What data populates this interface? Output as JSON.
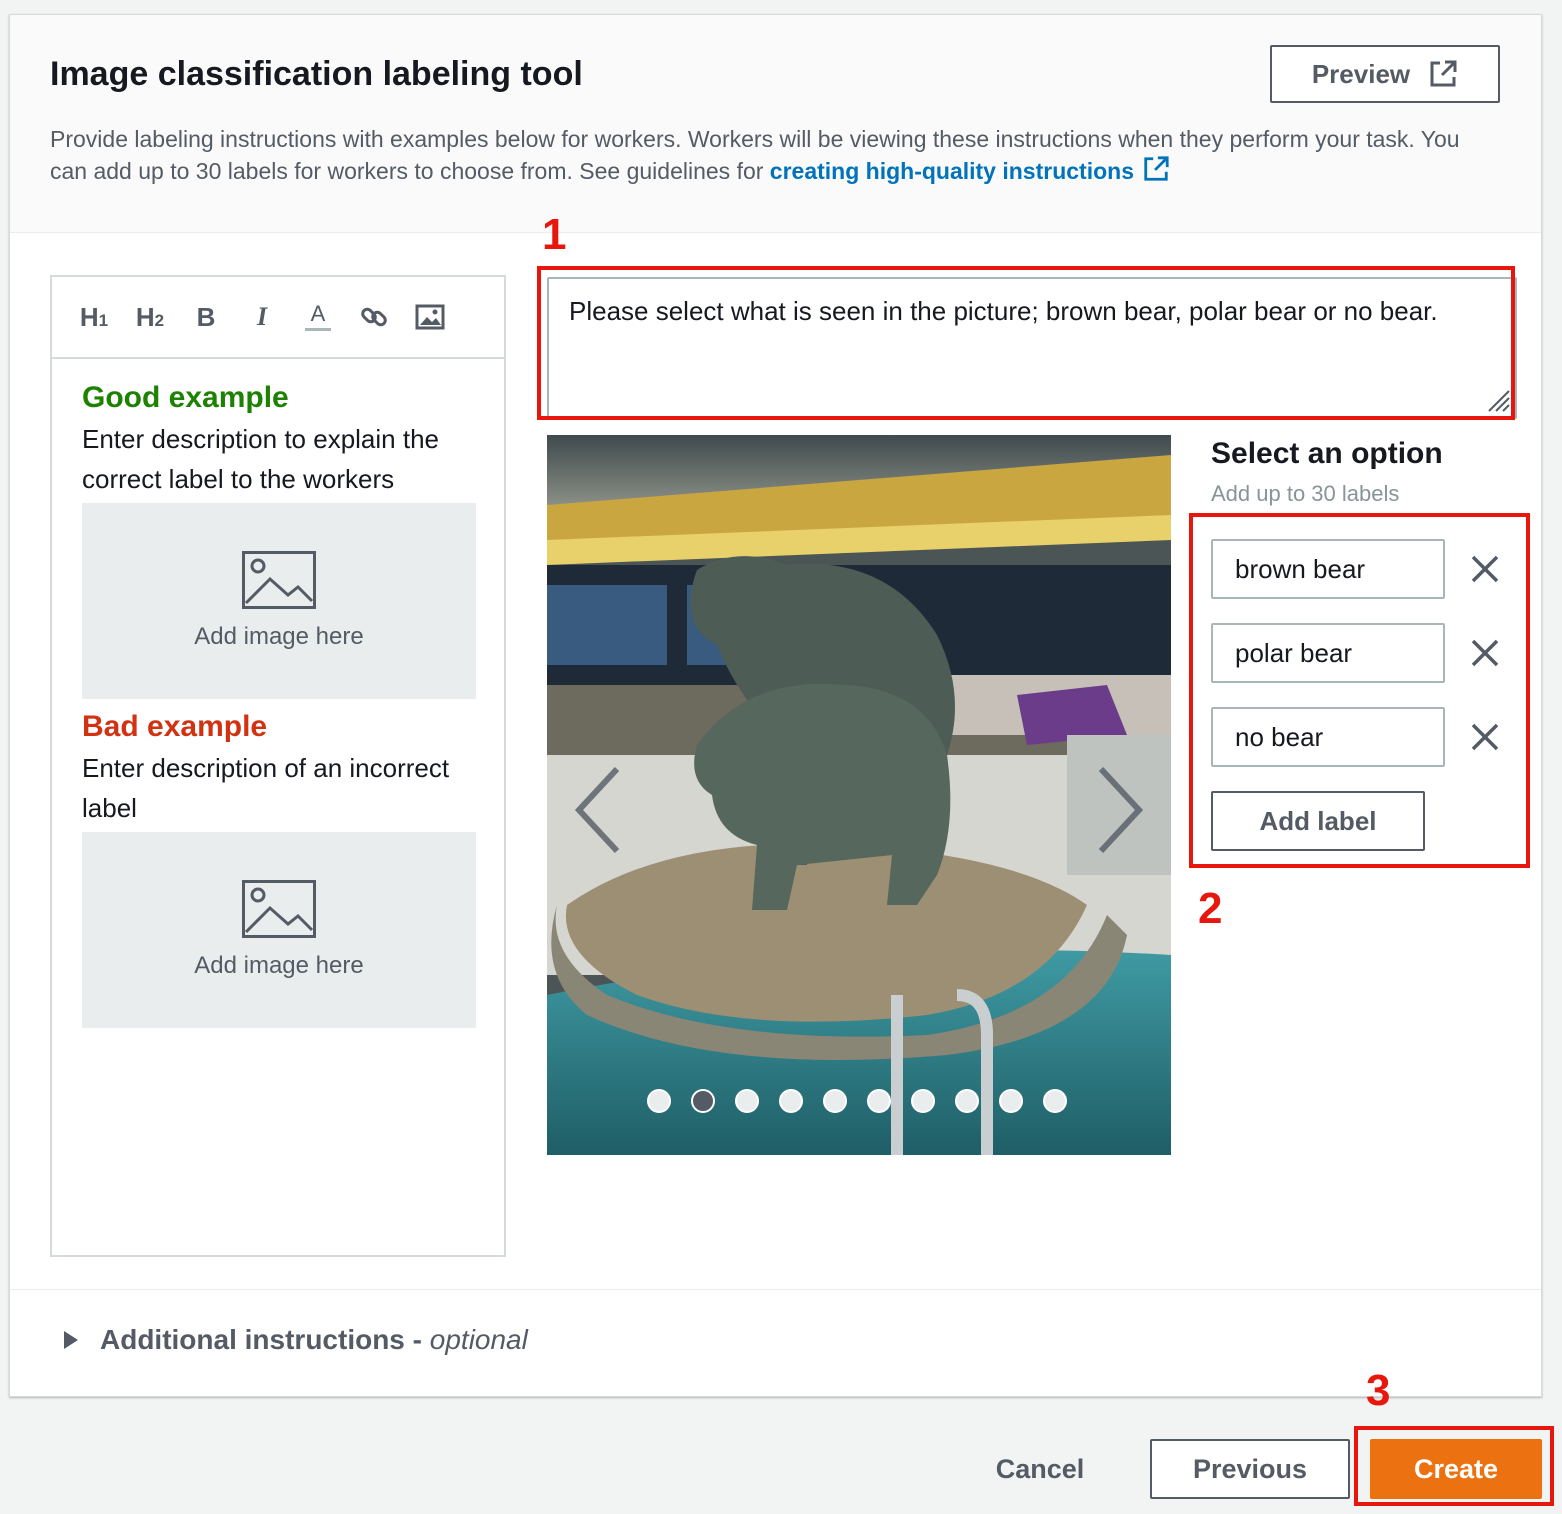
{
  "header": {
    "title": "Image classification labeling tool",
    "description": "Provide labeling instructions with examples below for workers. Workers will be viewing these instructions when they perform your task. You can add up to 30 labels for workers to choose from. See guidelines for ",
    "link_text": "creating high-quality instructions",
    "preview_label": "Preview"
  },
  "editor": {
    "toolbar": {
      "h1": "H",
      "h1_sub": "1",
      "h2": "H",
      "h2_sub": "2",
      "bold": "B",
      "italic": "I",
      "text_color": "A",
      "link_icon": "link-icon",
      "image_icon": "image-icon"
    },
    "good_example": {
      "title": "Good example",
      "text": "Enter description to explain the correct label to the workers",
      "placeholder": "Add image here"
    },
    "bad_example": {
      "title": "Bad example",
      "text": "Enter description of an incorrect label",
      "placeholder": "Add image here"
    }
  },
  "instructions": {
    "value": "Please select what is seen in the picture; brown bear, polar bear or no bear."
  },
  "carousel": {
    "dot_count": 10,
    "active_index": 1
  },
  "options": {
    "title": "Select an option",
    "subtitle": "Add up to 30 labels",
    "labels": [
      "brown bear",
      "polar bear",
      "no bear"
    ],
    "add_label": "Add label"
  },
  "additional": {
    "label": "Additional instructions - ",
    "optional": "optional"
  },
  "footer": {
    "cancel": "Cancel",
    "previous": "Previous",
    "create": "Create"
  },
  "annotations": [
    "1",
    "2",
    "3"
  ],
  "colors": {
    "accent_orange": "#ec7211",
    "link_blue": "#0073bb",
    "good_green": "#1d8102",
    "bad_red": "#d13212",
    "annotation_red": "#e8170d"
  }
}
